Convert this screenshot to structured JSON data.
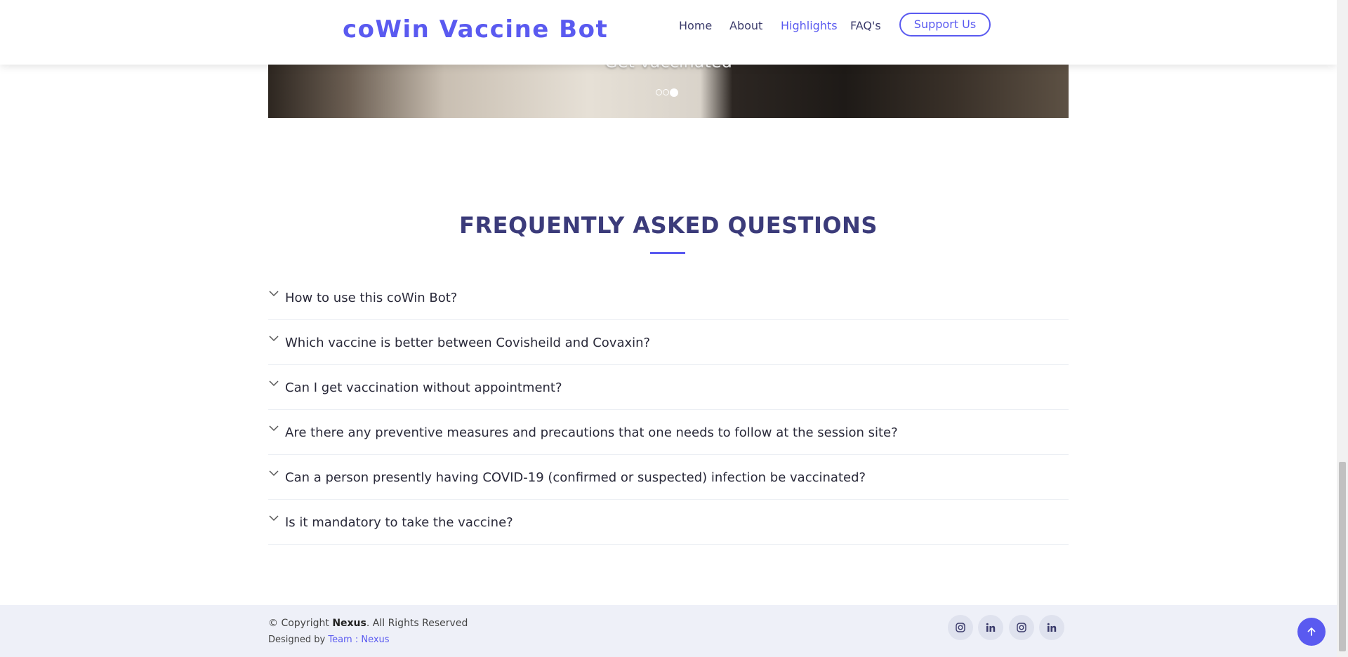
{
  "header": {
    "logo": "coWin Vaccine Bot",
    "nav": [
      {
        "label": "Home",
        "active": false
      },
      {
        "label": "About",
        "active": false
      },
      {
        "label": "Highlights",
        "active": true
      },
      {
        "label": "FAQ's",
        "active": false
      }
    ],
    "support_label": "Support Us"
  },
  "hero": {
    "caption": "Get vaccinated",
    "slide_count": 3,
    "active_slide": 3
  },
  "faq": {
    "title": "FREQUENTLY ASKED QUESTIONS",
    "items": [
      {
        "question": "How to use this coWin Bot?"
      },
      {
        "question": "Which vaccine is better between Covisheild and Covaxin?"
      },
      {
        "question": "Can I get vaccination without appointment?"
      },
      {
        "question": "Are there any preventive measures and precautions that one needs to follow at the session site?"
      },
      {
        "question": "Can a person presently having COVID-19 (confirmed or suspected) infection be vaccinated?"
      },
      {
        "question": "Is it mandatory to take the vaccine?"
      }
    ]
  },
  "footer": {
    "copyright_prefix": "© Copyright",
    "copyright_brand": "Nexus",
    "copyright_suffix": ". All Rights Reserved",
    "designed_by": "Designed by",
    "team_link": "Team : Nexus",
    "social": [
      {
        "icon": "instagram-icon"
      },
      {
        "icon": "linkedin-icon"
      },
      {
        "icon": "instagram-icon"
      },
      {
        "icon": "linkedin-icon"
      }
    ]
  },
  "colors": {
    "accent": "#5a5af0",
    "heading": "#3b3b7a",
    "footer_bg": "#eef0f8"
  }
}
